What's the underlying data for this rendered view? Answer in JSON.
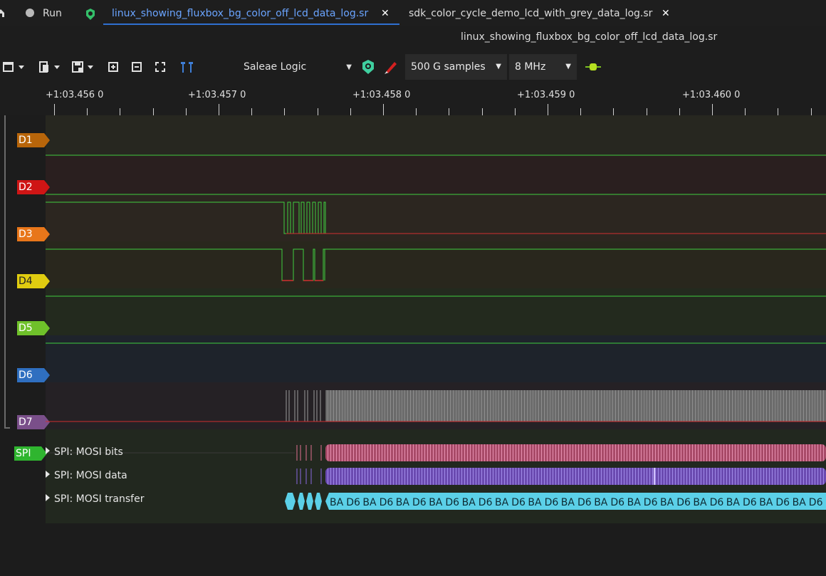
{
  "tabs": [
    {
      "label": "Run",
      "active": false,
      "closable": false
    },
    {
      "label": "linux_showing_fluxbox_bg_color_off_lcd_data_log.sr",
      "active": true,
      "closable": true
    },
    {
      "label": "sdk_color_cycle_demo_lcd_with_grey_data_log.sr",
      "active": false,
      "closable": true
    }
  ],
  "close_glyph": "✕",
  "file_title": "linux_showing_fluxbox_bg_color_off_lcd_data_log.sr",
  "toolbar": {
    "device": "Saleae Logic",
    "samples": "500 G samples",
    "samplerate": "8 MHz"
  },
  "ruler": {
    "labels": [
      "+1:03.456 0",
      "+1:03.457 0",
      "+1:03.458 0",
      "+1:03.459 0",
      "+1:03.460 0"
    ]
  },
  "channels": [
    {
      "name": "D1",
      "color": "#b8650a"
    },
    {
      "name": "D2",
      "color": "#cf1515"
    },
    {
      "name": "D3",
      "color": "#e8761a"
    },
    {
      "name": "D4",
      "color": "#e0cc10"
    },
    {
      "name": "D5",
      "color": "#6fc12a"
    },
    {
      "name": "D6",
      "color": "#2f6fc0"
    },
    {
      "name": "D7",
      "color": "#7a4f8a"
    }
  ],
  "decoder": {
    "name": "SPI",
    "color": "#2fb52f",
    "rows": [
      "SPI: MOSI bits",
      "SPI: MOSI data",
      "SPI: MOSI transfer"
    ],
    "transfer_bytes": [
      "BA",
      "D6",
      "BA",
      "D6",
      "BA",
      "D6",
      "BA",
      "D6",
      "BA",
      "D6",
      "BA",
      "D6",
      "BA",
      "D6",
      "BA",
      "D6",
      "BA",
      "D6",
      "BA",
      "D6",
      "BA",
      "D6",
      "BA",
      "D6",
      "BA",
      "D6",
      "BA",
      "D6",
      "BA",
      "D6",
      "BA",
      "D6"
    ]
  },
  "icons": [
    "home-icon",
    "run-icon",
    "logo-icon",
    "new-view-icon",
    "open-icon",
    "save-icon",
    "zoom-in-icon",
    "zoom-out-icon",
    "zoom-fit-icon",
    "cursor-icon",
    "device-config-icon",
    "probe-icon",
    "decoder-add-icon"
  ]
}
